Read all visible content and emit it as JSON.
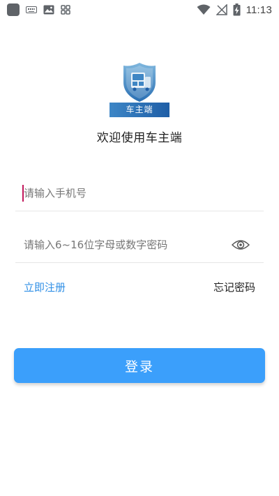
{
  "status_bar": {
    "time": "11:13"
  },
  "app": {
    "badge_text": "车主端",
    "welcome": "欢迎使用车主端",
    "brand_color": "#2f6fc0"
  },
  "form": {
    "phone_placeholder": "请输入手机号",
    "phone_value": "",
    "password_placeholder": "请输入6~16位字母或数字密码",
    "password_value": ""
  },
  "links": {
    "register": "立即注册",
    "forgot": "忘记密码"
  },
  "login_button": "登录",
  "colors": {
    "button": "#3b9ffb",
    "link": "#2f8fe6",
    "caret": "#c2185b"
  },
  "icons": {
    "password_toggle": "eye-icon"
  }
}
